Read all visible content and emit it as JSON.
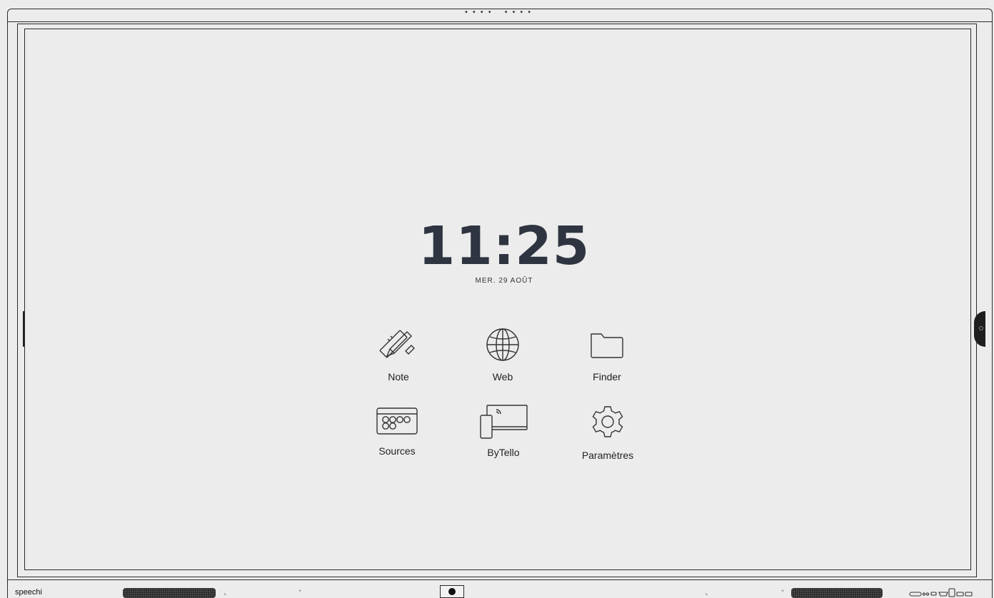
{
  "device": {
    "brand": "speechi"
  },
  "home": {
    "time": "11:25",
    "date": "MER. 29 AOÛT"
  },
  "apps": [
    {
      "id": "note",
      "label": "Note",
      "icon": "note-pencil-ruler-icon"
    },
    {
      "id": "web",
      "label": "Web",
      "icon": "globe-icon"
    },
    {
      "id": "finder",
      "label": "Finder",
      "icon": "folder-icon"
    },
    {
      "id": "sources",
      "label": "Sources",
      "icon": "input-sources-icon"
    },
    {
      "id": "bytello",
      "label": "ByTello",
      "icon": "screen-mirroring-icon"
    },
    {
      "id": "settings",
      "label": "Paramètres",
      "icon": "gear-icon"
    }
  ],
  "colors": {
    "background": "#ececec",
    "clock_text": "#2e3440",
    "bezel": "#2a2a2a"
  }
}
